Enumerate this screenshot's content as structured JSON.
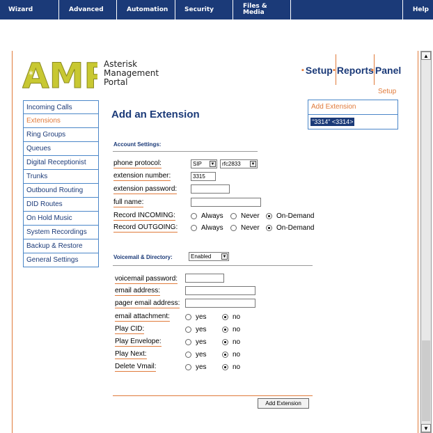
{
  "topnav": {
    "wizard": "Wizard",
    "advanced": "Advanced",
    "automation": "Automation",
    "security": "Security",
    "files_media_1": "Files &",
    "files_media_2": "Media",
    "help": "Help"
  },
  "logo": {
    "text": "AMP",
    "line1": "Asterisk",
    "line2": "Management",
    "line3": "Portal"
  },
  "rightnav": {
    "setup": "Setup",
    "reports": "Reports",
    "panel": "Panel",
    "sub": "Setup"
  },
  "menu": [
    "Incoming Calls",
    "Extensions",
    "Ring Groups",
    "Queues",
    "Digital Receptionist",
    "Trunks",
    "Outbound Routing",
    "DID Routes",
    "On Hold Music",
    "System Recordings",
    "Backup & Restore",
    "General Settings"
  ],
  "page_title": "Add an Extension",
  "side_box": {
    "header": "Add Extension",
    "entry": "\"3314\" <3314>"
  },
  "account": {
    "heading": "Account Settings:",
    "protocol_label": "phone protocol:",
    "protocol_value": "SIP",
    "dtmf_value": "rfc2833",
    "ext_label": "extension number:",
    "ext_value": "3315",
    "pwd_label": "extension password:",
    "name_label": "full name:",
    "rec_in_label": "Record INCOMING:",
    "rec_out_label": "Record OUTGOING:",
    "opt_always": "Always",
    "opt_never": "Never",
    "opt_ondemand": "On-Demand"
  },
  "voicemail": {
    "heading": "Voicemail & Directory:",
    "status_value": "Enabled",
    "vm_pwd_label": "voicemail password:",
    "email_label": "email address:",
    "pager_label": "pager email address:",
    "attach_label": "email attachment:",
    "cid_label": "Play CID:",
    "env_label": "Play Envelope:",
    "next_label": "Play Next:",
    "delete_label": "Delete Vmail:",
    "yes": "yes",
    "no": "no"
  },
  "submit": "Add Extension",
  "colors": {
    "navy": "#1b3a78",
    "orange": "#e07a3a",
    "menu_border": "#4a86c8",
    "logo": "#c8c832"
  }
}
